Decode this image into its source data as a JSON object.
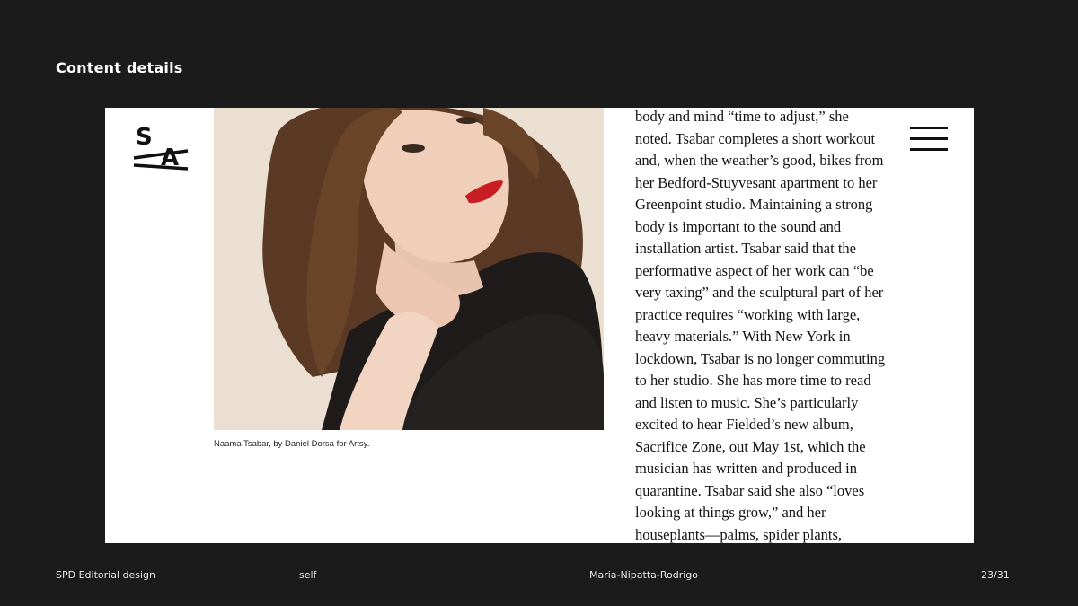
{
  "slide": {
    "title": "Content details"
  },
  "logo": {
    "letter_top": "S",
    "letter_bottom": "A"
  },
  "photo": {
    "caption": "Naama Tsabar, by Daniel Dorsa for Artsy."
  },
  "article": {
    "lines": [
      "body and mind “time to adjust,” she",
      "noted. Tsabar completes a short workout",
      "and, when the weather’s good, bikes from",
      "her Bedford-Stuyvesant apartment to her",
      "Greenpoint studio. Maintaining a strong",
      "body is important to the sound and",
      "installation artist. Tsabar said that the",
      "performative aspect of her work can “be",
      "very taxing” and the sculptural part of her",
      "practice requires “working with large,",
      "heavy materials.” With New York in",
      "lockdown, Tsabar is no longer commuting",
      "to her studio. She has more time to read",
      "and listen to music. She’s particularly",
      "excited to hear Fielded’s new album,",
      "Sacrifice Zone, out May 1st, which the",
      "musician has written and produced in",
      "quarantine. Tsabar said she also “loves",
      "looking at things grow,” and her",
      "houseplants—palms, spider plants,"
    ]
  },
  "menu": {
    "icon": "hamburger-menu-icon"
  },
  "footer": {
    "project": "SPD Editorial design",
    "type": "self",
    "author": "Maria-Nipatta-Rodrigo",
    "page": "23/31"
  }
}
